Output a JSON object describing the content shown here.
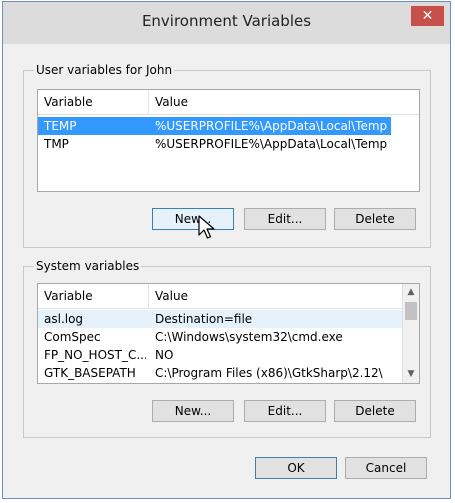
{
  "window": {
    "title": "Environment Variables",
    "close_glyph": "✕"
  },
  "user_vars": {
    "group_label": "User variables for John",
    "col_variable": "Variable",
    "col_value": "Value",
    "rows": [
      {
        "variable": "TEMP",
        "value": "%USERPROFILE%\\AppData\\Local\\Temp",
        "selected": true
      },
      {
        "variable": "TMP",
        "value": "%USERPROFILE%\\AppData\\Local\\Temp",
        "selected": false
      }
    ],
    "new_label": "New...",
    "edit_label": "Edit...",
    "delete_label": "Delete"
  },
  "system_vars": {
    "group_label": "System variables",
    "col_variable": "Variable",
    "col_value": "Value",
    "rows": [
      {
        "variable": "asl.log",
        "value": "Destination=file"
      },
      {
        "variable": "ComSpec",
        "value": "C:\\Windows\\system32\\cmd.exe"
      },
      {
        "variable": "FP_NO_HOST_C...",
        "value": "NO"
      },
      {
        "variable": "GTK_BASEPATH",
        "value": "C:\\Program Files (x86)\\GtkSharp\\2.12\\"
      }
    ],
    "new_label": "New...",
    "edit_label": "Edit...",
    "delete_label": "Delete"
  },
  "footer": {
    "ok_label": "OK",
    "cancel_label": "Cancel"
  },
  "colors": {
    "selection": "#3399ff",
    "close_button": "#c7504a",
    "default_button_border": "#3c7fb1"
  },
  "icons": {
    "cursor": "arrow-pointer-icon",
    "scroll_up": "chevron-up-icon",
    "scroll_down": "chevron-down-icon"
  }
}
